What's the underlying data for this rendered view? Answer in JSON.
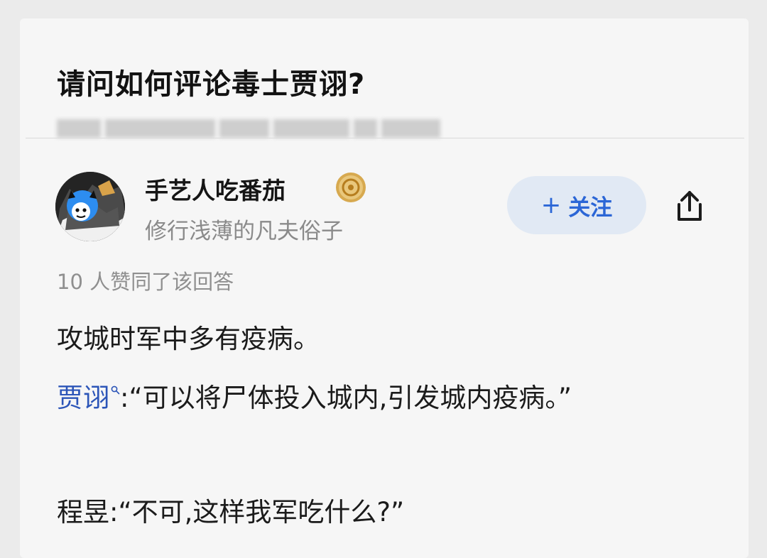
{
  "question": {
    "title": "请问如何评论毒士贾诩?"
  },
  "author": {
    "name": "手艺人吃番茄",
    "bio": "修行浅薄的凡夫俗子"
  },
  "actions": {
    "follow_plus": "+",
    "follow_label": "关注"
  },
  "answer": {
    "upvote_text": "10 人赞同了该回答",
    "paragraph1": "攻城时军中多有疫病。",
    "paragraph2_name": "贾诩",
    "paragraph2_text": ":“可以将尸体投入城内,引发城内疫病。”",
    "paragraph3": "程昱:“不可,这样我军吃什么?”"
  },
  "colors": {
    "link": "#2c55b8",
    "follow_bg": "#e1e9f4",
    "follow_text": "#2b66d6"
  },
  "icons": {
    "share": "share-icon",
    "search": "search-icon",
    "badge": "badge-icon"
  }
}
